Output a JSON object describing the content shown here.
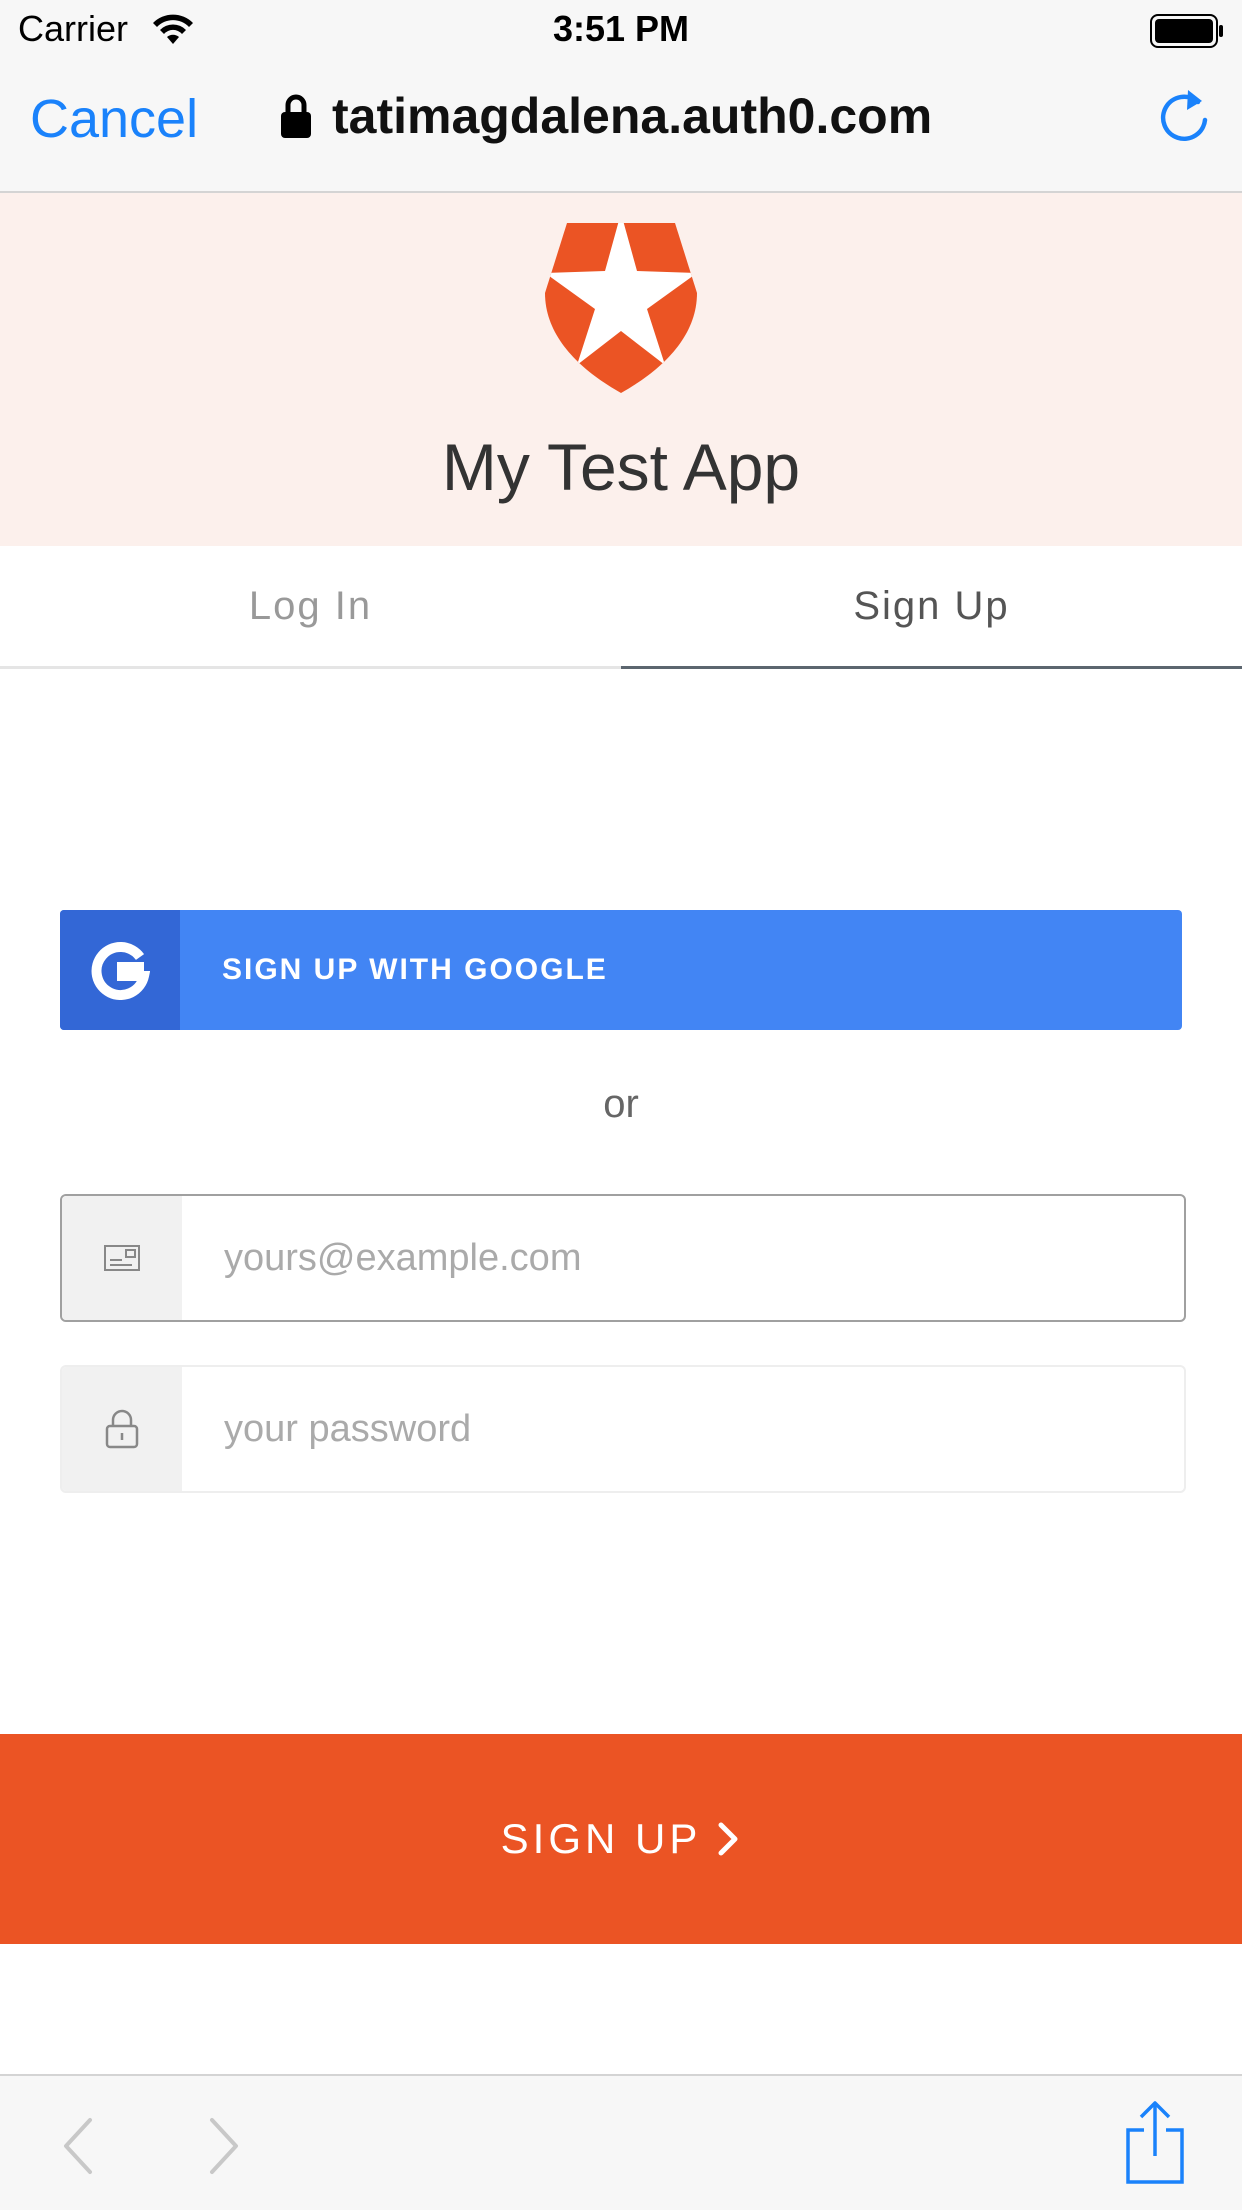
{
  "status_bar": {
    "carrier": "Carrier",
    "time": "3:51 PM"
  },
  "nav": {
    "cancel_label": "Cancel",
    "url": "tatimagdalena.auth0.com"
  },
  "header": {
    "app_title": "My Test App"
  },
  "tabs": [
    {
      "label": "Log In",
      "active": false
    },
    {
      "label": "Sign Up",
      "active": true
    }
  ],
  "social": {
    "google_label": "SIGN UP WITH GOOGLE"
  },
  "divider_text": "or",
  "form": {
    "email": {
      "value": "",
      "placeholder": "yours@example.com"
    },
    "password": {
      "value": "",
      "placeholder": "your password"
    }
  },
  "submit": {
    "label": "SIGN UP"
  },
  "colors": {
    "accent": "#eb5424",
    "ios_blue": "#1a82fb",
    "google_blue": "#4285f4",
    "google_dark": "#3367d6",
    "header_bg": "#fcf0ec"
  },
  "icons": [
    "wifi-icon",
    "battery-icon",
    "lock-icon",
    "reload-icon",
    "auth0-logo",
    "google-icon",
    "email-icon",
    "password-lock-icon",
    "chevron-right-icon",
    "back-icon",
    "forward-icon",
    "share-icon"
  ]
}
